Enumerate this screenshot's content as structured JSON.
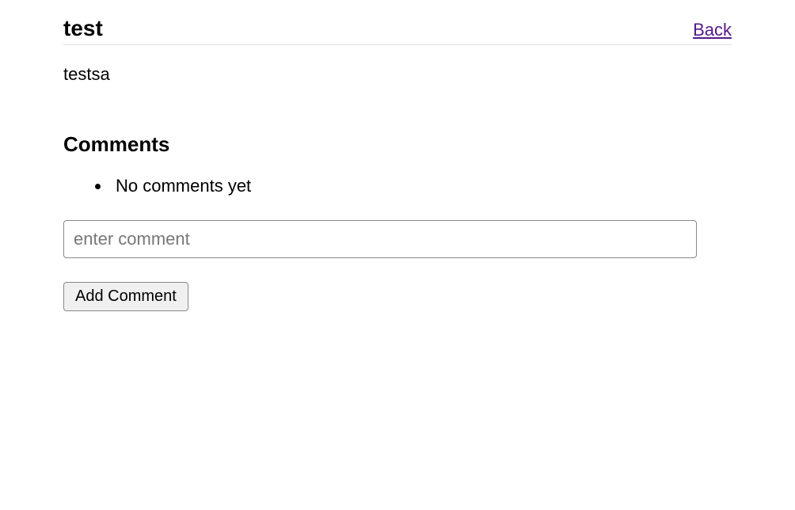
{
  "header": {
    "title": "test",
    "back_label": "Back"
  },
  "body": {
    "text": "testsa"
  },
  "comments": {
    "heading": "Comments",
    "empty_message": "No comments yet",
    "input_placeholder": "enter comment",
    "add_button_label": "Add Comment"
  }
}
